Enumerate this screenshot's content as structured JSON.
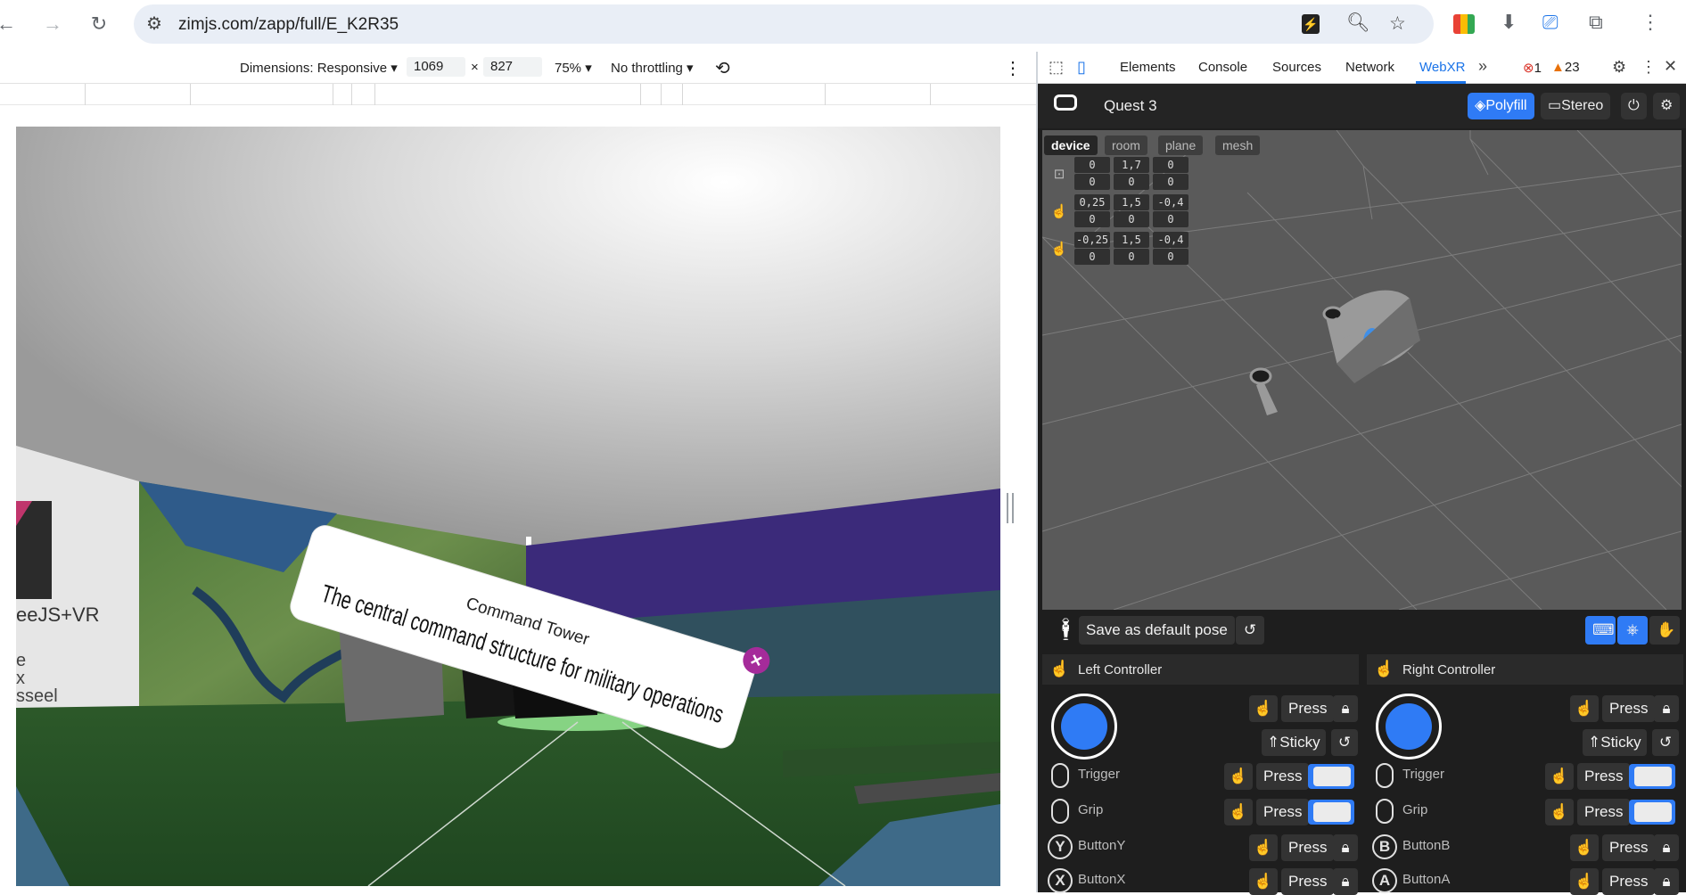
{
  "browser": {
    "url": "zimjs.com/zapp/full/E_K2R35"
  },
  "device_toolbar": {
    "dimensions_label": "Dimensions: Responsive",
    "width": "1069",
    "times": "×",
    "height": "827",
    "zoom": "75%",
    "throttling": "No throttling"
  },
  "devtools_tabs": [
    "Elements",
    "Console",
    "Sources",
    "Network",
    "WebXR"
  ],
  "devtools_status": {
    "errors": "1",
    "warnings": "23"
  },
  "scene": {
    "panel_title": "Command Tower",
    "panel_text": "The central command structure for military operations",
    "close_glyph": "×",
    "sign_text": "eeJS+VR",
    "sign_lines": [
      "e",
      "x",
      "sseel"
    ]
  },
  "webxr": {
    "device_name": "Quest 3",
    "polyfill_label": "Polyfill",
    "stereo_label": "Stereo",
    "view_tabs": [
      "device",
      "room",
      "plane",
      "mesh"
    ],
    "active_view_tab": "device",
    "pose_rows": [
      {
        "icon": "headset-icon",
        "pos": [
          "0",
          "1,7",
          "0"
        ],
        "rot": [
          "0",
          "0",
          "0"
        ]
      },
      {
        "icon": "right-controller-icon",
        "pos": [
          "0,25",
          "1,5",
          "-0,4"
        ],
        "rot": [
          "0",
          "0",
          "0"
        ]
      },
      {
        "icon": "left-controller-icon",
        "pos": [
          "-0,25",
          "1,5",
          "-0,4"
        ],
        "rot": [
          "0",
          "0",
          "0"
        ]
      }
    ],
    "save_pose_label": "Save as default pose",
    "controllers": [
      {
        "title": "Left Controller",
        "press_label": "Press",
        "sticky_label": "Sticky",
        "rows": [
          {
            "label": "Trigger",
            "icon_letter": "",
            "type": "slider",
            "press": "Press"
          },
          {
            "label": "Grip",
            "icon_letter": "",
            "type": "slider",
            "press": "Press"
          },
          {
            "label": "ButtonY",
            "icon_letter": "Y",
            "type": "lock",
            "press": "Press"
          },
          {
            "label": "ButtonX",
            "icon_letter": "X",
            "type": "lock",
            "press": "Press"
          }
        ]
      },
      {
        "title": "Right Controller",
        "press_label": "Press",
        "sticky_label": "Sticky",
        "rows": [
          {
            "label": "Trigger",
            "icon_letter": "",
            "type": "slider",
            "press": "Press"
          },
          {
            "label": "Grip",
            "icon_letter": "",
            "type": "slider",
            "press": "Press"
          },
          {
            "label": "ButtonB",
            "icon_letter": "B",
            "type": "lock",
            "press": "Press"
          },
          {
            "label": "ButtonA",
            "icon_letter": "A",
            "type": "lock",
            "press": "Press"
          }
        ]
      }
    ]
  },
  "colors": {
    "accent_blue": "#1a73e8",
    "webxr_blue": "#2f7bf5",
    "floor_green": "#2f5b2c",
    "purple_wall": "#3b2a7a"
  }
}
